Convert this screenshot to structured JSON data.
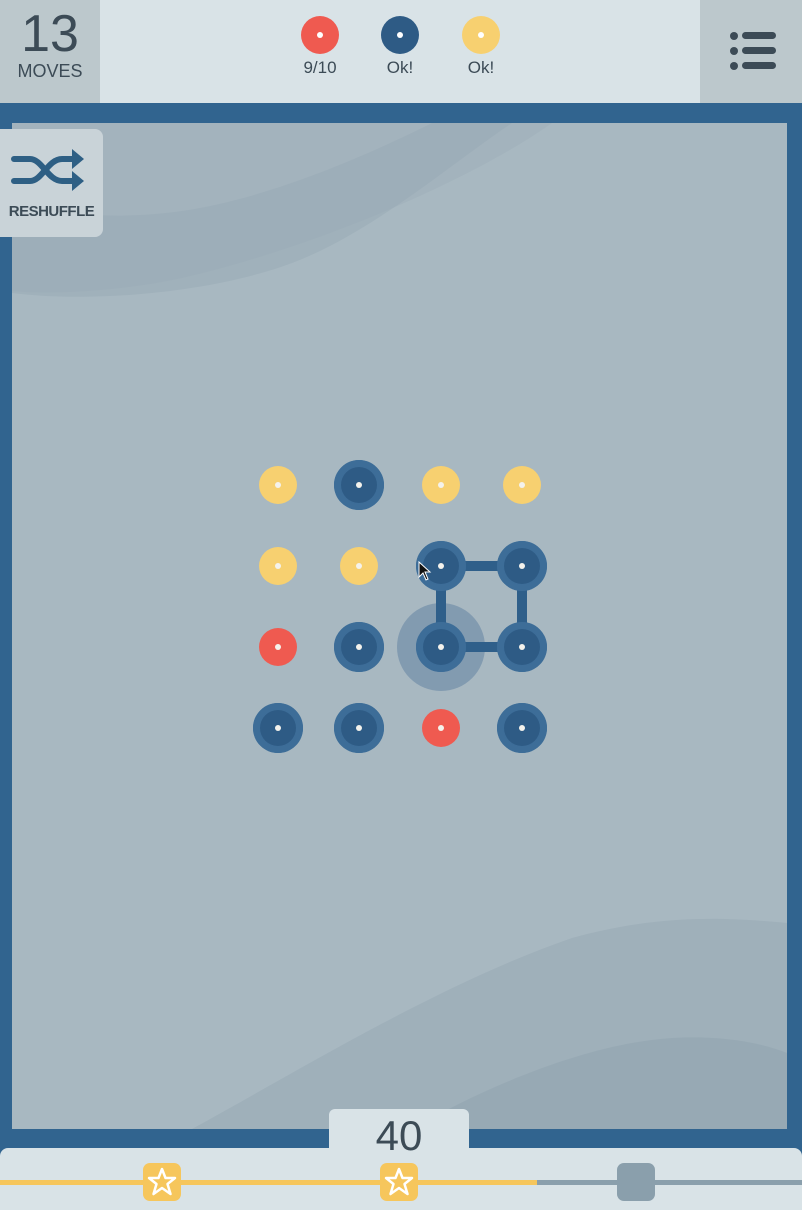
{
  "moves": {
    "count": "13",
    "label": "MOVES"
  },
  "goals": [
    {
      "color": "#ef5a50",
      "label": "9/10"
    },
    {
      "color": "#2e5b85",
      "label": "Ok!"
    },
    {
      "color": "#f7d070",
      "label": "Ok!"
    }
  ],
  "reshuffle": {
    "label": "RESHUFFLE",
    "icon": "shuffle-icon"
  },
  "menu": {
    "icon": "list-menu-icon"
  },
  "palette": {
    "red": "#ef5a50",
    "blue": "#2e5b85",
    "yellow": "#f7d070"
  },
  "grid": {
    "rows": [
      [
        "yellow",
        "blue",
        "yellow",
        "yellow"
      ],
      [
        "yellow",
        "yellow",
        "blue",
        "blue"
      ],
      [
        "red",
        "blue",
        "blue",
        "blue"
      ],
      [
        "blue",
        "blue",
        "red",
        "blue"
      ]
    ]
  },
  "score": {
    "value": "40",
    "progress": 0.67,
    "stars_earned": 2
  }
}
